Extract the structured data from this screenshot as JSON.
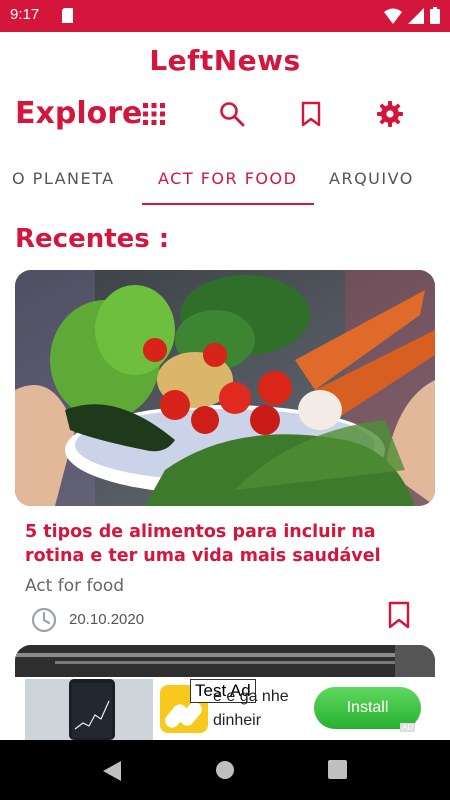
{
  "status_bar": {
    "time": "9:17"
  },
  "app": {
    "title": "LeftNews"
  },
  "header": {
    "explore_label": "Explore"
  },
  "tabs": [
    {
      "label": "O PLANETA"
    },
    {
      "label": "ACT FOR FOOD"
    },
    {
      "label": "ARQUIVO"
    }
  ],
  "section": {
    "title": "Recentes :"
  },
  "article": {
    "title": "5 tipos de alimentos para incluir na rotina e ter uma vida mais saudável",
    "category": "Act for food",
    "date": "20.10.2020"
  },
  "ad": {
    "label": "Test Ad",
    "text": "e e ga nhe dinheir",
    "install_label": "Install",
    "badge": "AD"
  },
  "colors": {
    "accent": "#d4163c",
    "status_bar": "#d4163c",
    "install_button": "#2fbf3a"
  },
  "icons": [
    "sim-card-icon",
    "wifi-icon",
    "signal-icon",
    "battery-icon",
    "grid-icon",
    "search-icon",
    "bookmark-icon",
    "settings-gear-icon",
    "clock-icon",
    "back-icon",
    "home-icon",
    "recents-icon"
  ]
}
